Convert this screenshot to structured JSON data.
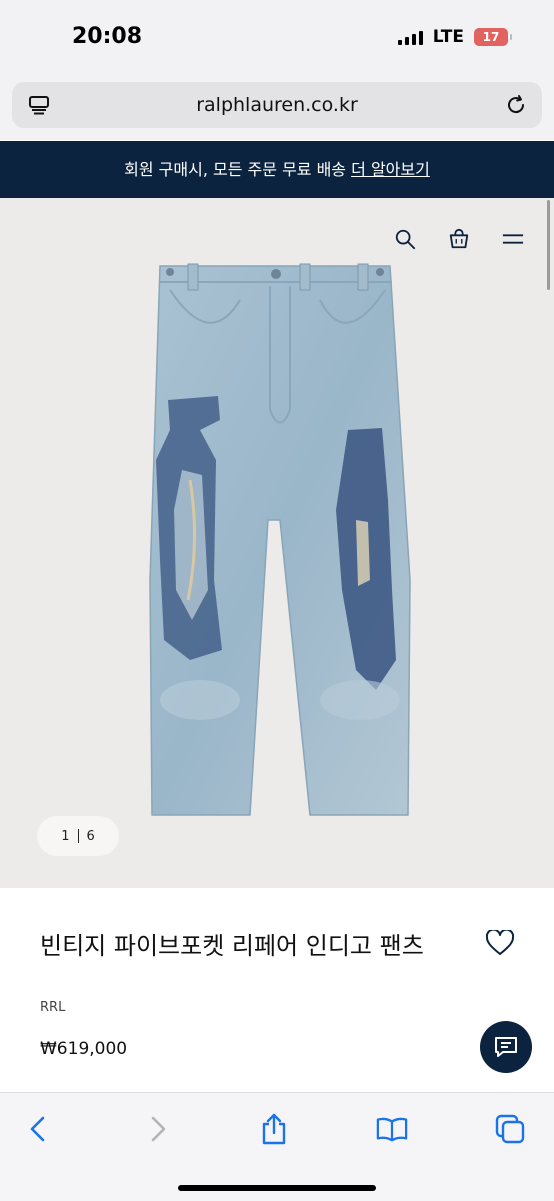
{
  "status_bar": {
    "time": "20:08",
    "network": "LTE",
    "battery": "17"
  },
  "browser": {
    "url": "ralphlauren.co.kr"
  },
  "promo": {
    "text": "회원 구매시, 모든 주문 무료 배송",
    "link": "더 알아보기"
  },
  "gallery": {
    "current": "1",
    "total": "6"
  },
  "product": {
    "title": "빈티지 파이브포켓 리페어 인디고 팬츠",
    "brand": "RRL",
    "price": "₩619,000"
  },
  "colors": {
    "navy": "#0c2340",
    "safari_blue": "#1a73e8"
  },
  "icons": [
    "tabs-icon",
    "reload-icon",
    "search-icon",
    "bag-icon",
    "menu-icon",
    "heart-icon",
    "chat-icon",
    "back-icon",
    "forward-icon",
    "share-icon",
    "bookmarks-icon",
    "tabs-overview-icon"
  ]
}
